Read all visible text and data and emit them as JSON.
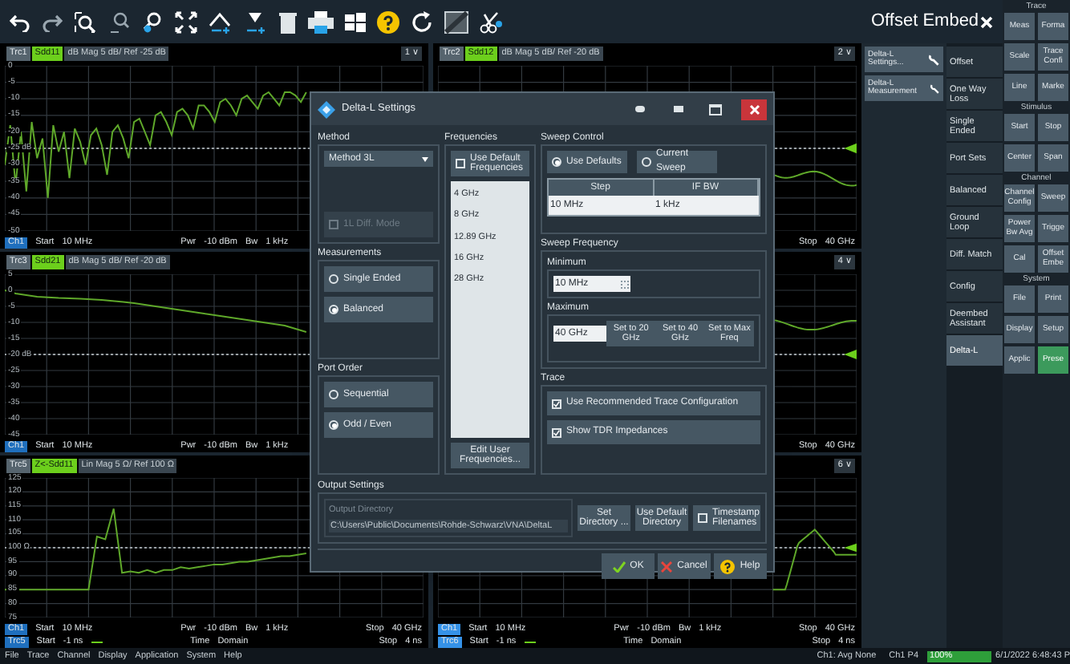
{
  "panes": [
    {
      "trace": "Trc1",
      "scale": "dB Mag 5 dB/ Ref -25 dB",
      "selector": "1 ∨",
      "chart_data": {
        "type": "line",
        "grid": true,
        "ref_lines": [
          {
            "axis": "y",
            "value": -25
          }
        ],
        "ylim": [
          -50,
          0
        ],
        "yticks": [
          0,
          -5,
          -10,
          -15,
          -20,
          {
            "value": -25,
            "label": "-25 dB"
          },
          -30,
          -35,
          -40,
          -45,
          -50
        ],
        "categories": [
          null,
          null,
          null,
          null,
          null,
          null,
          null,
          null,
          null,
          null,
          null,
          null,
          null,
          null,
          null,
          null,
          null,
          null,
          null,
          null,
          null,
          null,
          null,
          null,
          null,
          null,
          null,
          null,
          null,
          null,
          null,
          null,
          null,
          null,
          null,
          null,
          null,
          null,
          null,
          null,
          null,
          null,
          null,
          null,
          null,
          null,
          null,
          null,
          null,
          null,
          null,
          null,
          null,
          null,
          null,
          null,
          null
        ],
        "series": [
          {
            "name": "Sdd11",
            "color": "#5fa82a",
            "values": [
              -30,
              -18,
              -36,
              -20,
              -38,
              -17,
              -28,
              -22,
              -40,
              -18,
              -26,
              -20,
              -34,
              -19,
              -23,
              -30,
              -21,
              -19,
              -24,
              -33,
              -20,
              -18,
              -22,
              -28,
              -17,
              -16,
              -20,
              -24,
              -15,
              -14,
              -17,
              -21,
              -14,
              -13,
              -15,
              -19,
              -12,
              -12,
              -14,
              -17,
              -11,
              -10,
              -12,
              -15,
              -10,
              -9,
              -11,
              -13,
              -9,
              -8,
              -10,
              -12,
              -8,
              -8,
              -9,
              -11,
              -8
            ]
          }
        ]
      },
      "footer": [
        {
          "channel": "Ch1",
          "start": "Start",
          "start_value": "10 MHz",
          "middle": [
            "Pwr",
            "-10 dBm",
            "Bw",
            "1 kHz"
          ]
        }
      ]
    },
    {
      "trace": "Trc2",
      "measurement": "Sdd12",
      "scale": "dB Mag 5 dB/ Ref -20 dB",
      "selector": "2 ∨",
      "kind": "decline",
      "footer": [
        {
          "stop": "Stop",
          "stop_value": "40 GHz"
        }
      ]
    },
    {
      "trace": "Trc3",
      "scale": "dB Mag 5 dB/ Ref -20 dB",
      "chart_data": {
        "type": "line",
        "grid": true,
        "ref_lines": [
          {
            "axis": "y",
            "value": -20
          }
        ],
        "ylim": [
          -45,
          5
        ],
        "yticks": [
          5,
          0,
          -5,
          -10,
          -15,
          {
            "value": -20,
            "label": "-20 dB"
          },
          -25,
          -30,
          -35,
          -40,
          -45
        ],
        "categories": [
          null,
          null,
          null,
          null,
          null,
          null,
          null,
          null,
          null,
          null,
          null,
          null,
          null,
          null,
          null,
          null,
          null,
          null,
          null,
          null,
          null,
          null,
          null,
          null,
          null,
          null,
          null,
          null,
          null
        ],
        "series": [
          {
            "name": "Sdd21",
            "color": "#5fa82a",
            "values": [
              0,
              -1,
              -1.5,
              -2,
              -2.2,
              -2.4,
              -2.5,
              -2.6,
              -2.8,
              -3,
              -3.3,
              -3.6,
              -4,
              -4.5,
              -5,
              -5.5,
              -6,
              -6.5,
              -7,
              -7.5,
              -8,
              -8.5,
              -9,
              -9.5,
              -10,
              -10.5,
              -11,
              -12,
              -13
            ]
          }
        ]
      },
      "footer": [
        {
          "channel": "Ch1",
          "start": "Start",
          "start_value": "10 MHz",
          "middle": [
            "Pwr",
            "-10 dBm",
            "Bw",
            "1 kHz"
          ]
        }
      ]
    },
    {
      "selector": "4 ∨",
      "kind": "wave",
      "footer": [
        {
          "stop": "Stop",
          "stop_value": "40 GHz"
        }
      ]
    },
    {
      "trace": "Trc5",
      "scale": "Lin Mag 5 Ω/ Ref 100 Ω",
      "chart_data": {
        "type": "line",
        "grid": true,
        "ref_lines": [
          {
            "axis": "y",
            "value": 100
          }
        ],
        "ylim": [
          75,
          125
        ],
        "yticks": [
          125,
          120,
          115,
          110,
          105,
          {
            "value": 100,
            "label": "100 Ω"
          },
          95,
          90,
          85,
          80,
          75
        ],
        "categories": [
          null,
          null,
          null,
          null,
          null,
          null,
          null,
          null,
          null,
          null,
          null,
          null,
          null,
          null,
          null,
          null,
          null,
          null,
          null,
          null,
          null,
          null,
          null,
          null,
          null,
          null,
          null,
          null,
          null,
          null,
          null,
          null,
          null,
          null,
          null,
          null,
          null
        ],
        "series": [
          {
            "name": "Z<-Sdd11",
            "color": "#5fa82a",
            "values": [
              85,
              85,
              85,
              85,
              85,
              85,
              85,
              85,
              85,
              85,
              85,
              104,
              103,
              114,
              91,
              91.5,
              91,
              92,
              91,
              92,
              92,
              93,
              92.5,
              93,
              93.5,
              94,
              94,
              94.5,
              95,
              95,
              95.5,
              96,
              96.5,
              97,
              97,
              97.5,
              98
            ]
          }
        ]
      },
      "footer": [
        {
          "channel": "Ch1",
          "start": "Start",
          "start_value": "10 MHz",
          "middle": [
            "Pwr",
            "-10 dBm",
            "Bw",
            "1 kHz"
          ],
          "stop": "Stop",
          "stop_value": "40 GHz"
        },
        {
          "channel": "Trc5",
          "start": "Start",
          "start_value": "-1 ns",
          "line": true,
          "middle": [
            "Time",
            "Domain"
          ],
          "stop": "Stop",
          "stop_value": "4 ns"
        }
      ]
    },
    {
      "selector": "6 ∨",
      "kind": "bump",
      "footer": [
        {
          "channel": "Ch1",
          "channel_selected": true,
          "start": "Start",
          "start_value": "10 MHz",
          "middle": [
            "Pwr",
            "-10 dBm",
            "Bw",
            "1 kHz"
          ],
          "stop": "Stop",
          "stop_value": "40 GHz"
        },
        {
          "channel": "Trc6",
          "channel_selected": true,
          "start": "Start",
          "start_value": "-1 ns",
          "line": true,
          "middle": [
            "Time",
            "Domain"
          ],
          "stop": "Stop",
          "stop_value": "4 ns"
        }
      ]
    }
  ],
  "dialog": {
    "title": "Delta-L Settings",
    "method": {
      "label": "Method",
      "value": "Method 3L",
      "mode": {
        "label": "1L Diff. Mode",
        "checked": false,
        "disabled": true
      }
    },
    "measurements": {
      "label": "Measurements",
      "options": [
        {
          "label": "Single Ended",
          "selected": false
        },
        {
          "label": "Balanced",
          "selected": true
        }
      ]
    },
    "port_order": {
      "label": "Port Order",
      "options": [
        {
          "label": "Sequential",
          "selected": false
        },
        {
          "label": "Odd / Even",
          "selected": true
        }
      ]
    },
    "frequencies": {
      "label": "Frequencies",
      "use_default": {
        "label": "Use Default Frequencies",
        "checked": false
      },
      "items": [
        "4 GHz",
        "8 GHz",
        "12.89 GHz",
        "16 GHz",
        "28 GHz"
      ],
      "edit_button": "Edit User Frequencies..."
    },
    "sweep_control": {
      "label": "Sweep Control",
      "options": [
        {
          "label": "Use Defaults",
          "selected": true
        },
        {
          "label": "Current Sweep",
          "selected": false
        }
      ],
      "table": {
        "columns": [
          "Step",
          "IF BW"
        ],
        "rows": [
          [
            "10 MHz",
            "1 kHz"
          ]
        ]
      }
    },
    "sweep_frequency": {
      "label": "Sweep Frequency",
      "minimum": {
        "label": "Minimum",
        "value": "10 MHz"
      },
      "maximum": {
        "label": "Maximum",
        "value": "40 GHz",
        "presets": [
          "Set to 20 GHz",
          "Set to 40 GHz",
          "Set to Max Freq"
        ]
      }
    },
    "trace": {
      "label": "Trace",
      "options": [
        {
          "label": "Use Recommended Trace Configuration",
          "checked": true
        },
        {
          "label": "Show TDR Impedances",
          "checked": true
        }
      ]
    },
    "output": {
      "label": "Output Settings",
      "directory": {
        "label": "Output Directory",
        "value": "C:\\Users\\Public\\Documents\\Rohde-Schwarz\\VNA\\DeltaL"
      },
      "buttons": [
        "Set Directory ...",
        "Use Default Directory"
      ],
      "timestamp": {
        "label": "Timestamp Filenames",
        "checked": false
      }
    },
    "buttons": [
      {
        "label": "OK",
        "kind": "ok"
      },
      {
        "label": "Cancel",
        "kind": "cancel"
      },
      {
        "label": "Help",
        "kind": "help"
      }
    ]
  },
  "offset_panel": {
    "title": "Offset Embed",
    "actions": [
      "Delta-L Settings...",
      "Delta-L Measurement"
    ],
    "softkeys": [
      {
        "label": "Offset",
        "selected": false
      },
      {
        "label": "One Way Loss",
        "selected": false
      },
      {
        "label": "Single Ended",
        "selected": false
      },
      {
        "label": "Port Sets",
        "selected": false
      },
      {
        "label": "Balanced",
        "selected": false
      },
      {
        "label": "Ground Loop",
        "selected": false
      },
      {
        "label": "Diff. Match",
        "selected": false
      },
      {
        "label": "Config",
        "selected": false
      },
      {
        "label": "Deembed Assistant",
        "selected": false
      },
      {
        "label": "Delta-L",
        "selected": true
      }
    ]
  },
  "hardkeys": [
    {
      "section": "Trace",
      "keys": [
        {
          "label": "Meas",
          "selected": false
        },
        {
          "label": "Forma",
          "selected": false
        },
        {
          "label": "Scale",
          "selected": false
        },
        {
          "label": "Trace Confi",
          "selected": false
        },
        {
          "label": "Line",
          "selected": false
        },
        {
          "label": "Marke",
          "selected": false
        }
      ]
    },
    {
      "section": "Stimulus",
      "keys": [
        {
          "label": "Start",
          "selected": false
        },
        {
          "label": "Stop",
          "selected": false
        },
        {
          "label": "Center",
          "selected": false
        },
        {
          "label": "Span",
          "selected": false
        }
      ]
    },
    {
      "section": "Channel",
      "keys": [
        {
          "label": "Channel Config",
          "selected": false
        },
        {
          "label": "Sweep",
          "selected": false
        },
        {
          "label": "Power Bw Avg",
          "selected": false
        },
        {
          "label": "Trigge",
          "selected": false
        },
        {
          "label": "Cal",
          "selected": false
        },
        {
          "label": "Offset Embe",
          "selected": false
        }
      ]
    },
    {
      "section": "System",
      "keys": [
        {
          "label": "File",
          "selected": false
        },
        {
          "label": "Print",
          "selected": false
        },
        {
          "label": "Display",
          "selected": false
        },
        {
          "label": "Setup",
          "selected": false
        },
        {
          "label": "Applic",
          "selected": false
        },
        {
          "label": "Prese",
          "selected": true
        }
      ]
    }
  ],
  "menu_bar": [
    "File",
    "Trace",
    "Channel",
    "Display",
    "Application",
    "System",
    "Help"
  ],
  "status_bar": {
    "averaging": "Ch1: Avg None",
    "port": "Ch1 P4",
    "progress": {
      "label": "100%",
      "level": 1
    },
    "datetime": "6/1/2022 6:48:43 P"
  }
}
